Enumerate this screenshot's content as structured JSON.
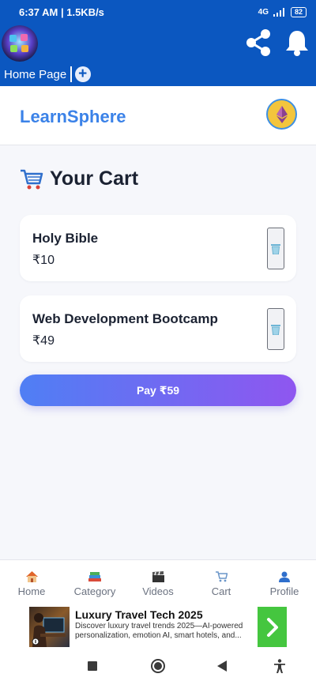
{
  "status_bar": {
    "time_speed": "6:37 AM | 1.5KB/s",
    "network": "4G",
    "battery": "82"
  },
  "app_bar": {
    "breadcrumb": "Home Page"
  },
  "site": {
    "brand": "LearnSphere"
  },
  "cart": {
    "title": "Your Cart",
    "items": [
      {
        "name": "Holy Bible",
        "price": "₹10"
      },
      {
        "name": "Web Development Bootcamp",
        "price": "₹49"
      }
    ],
    "pay_label": "Pay ₹59"
  },
  "bottom_nav": [
    {
      "label": "Home",
      "icon": "house-icon"
    },
    {
      "label": "Category",
      "icon": "books-icon"
    },
    {
      "label": "Videos",
      "icon": "clapper-icon"
    },
    {
      "label": "Cart",
      "icon": "cart-icon"
    },
    {
      "label": "Profile",
      "icon": "user-icon"
    }
  ],
  "ad": {
    "title": "Luxury Travel Tech 2025",
    "description": "Discover luxury travel trends 2025—AI-powered personalization, emotion AI, smart hotels, and..."
  },
  "colors": {
    "primary": "#0b57c0",
    "brand": "#3b82e8",
    "pay_start": "#4f7ff4",
    "pay_end": "#8f56f0"
  }
}
